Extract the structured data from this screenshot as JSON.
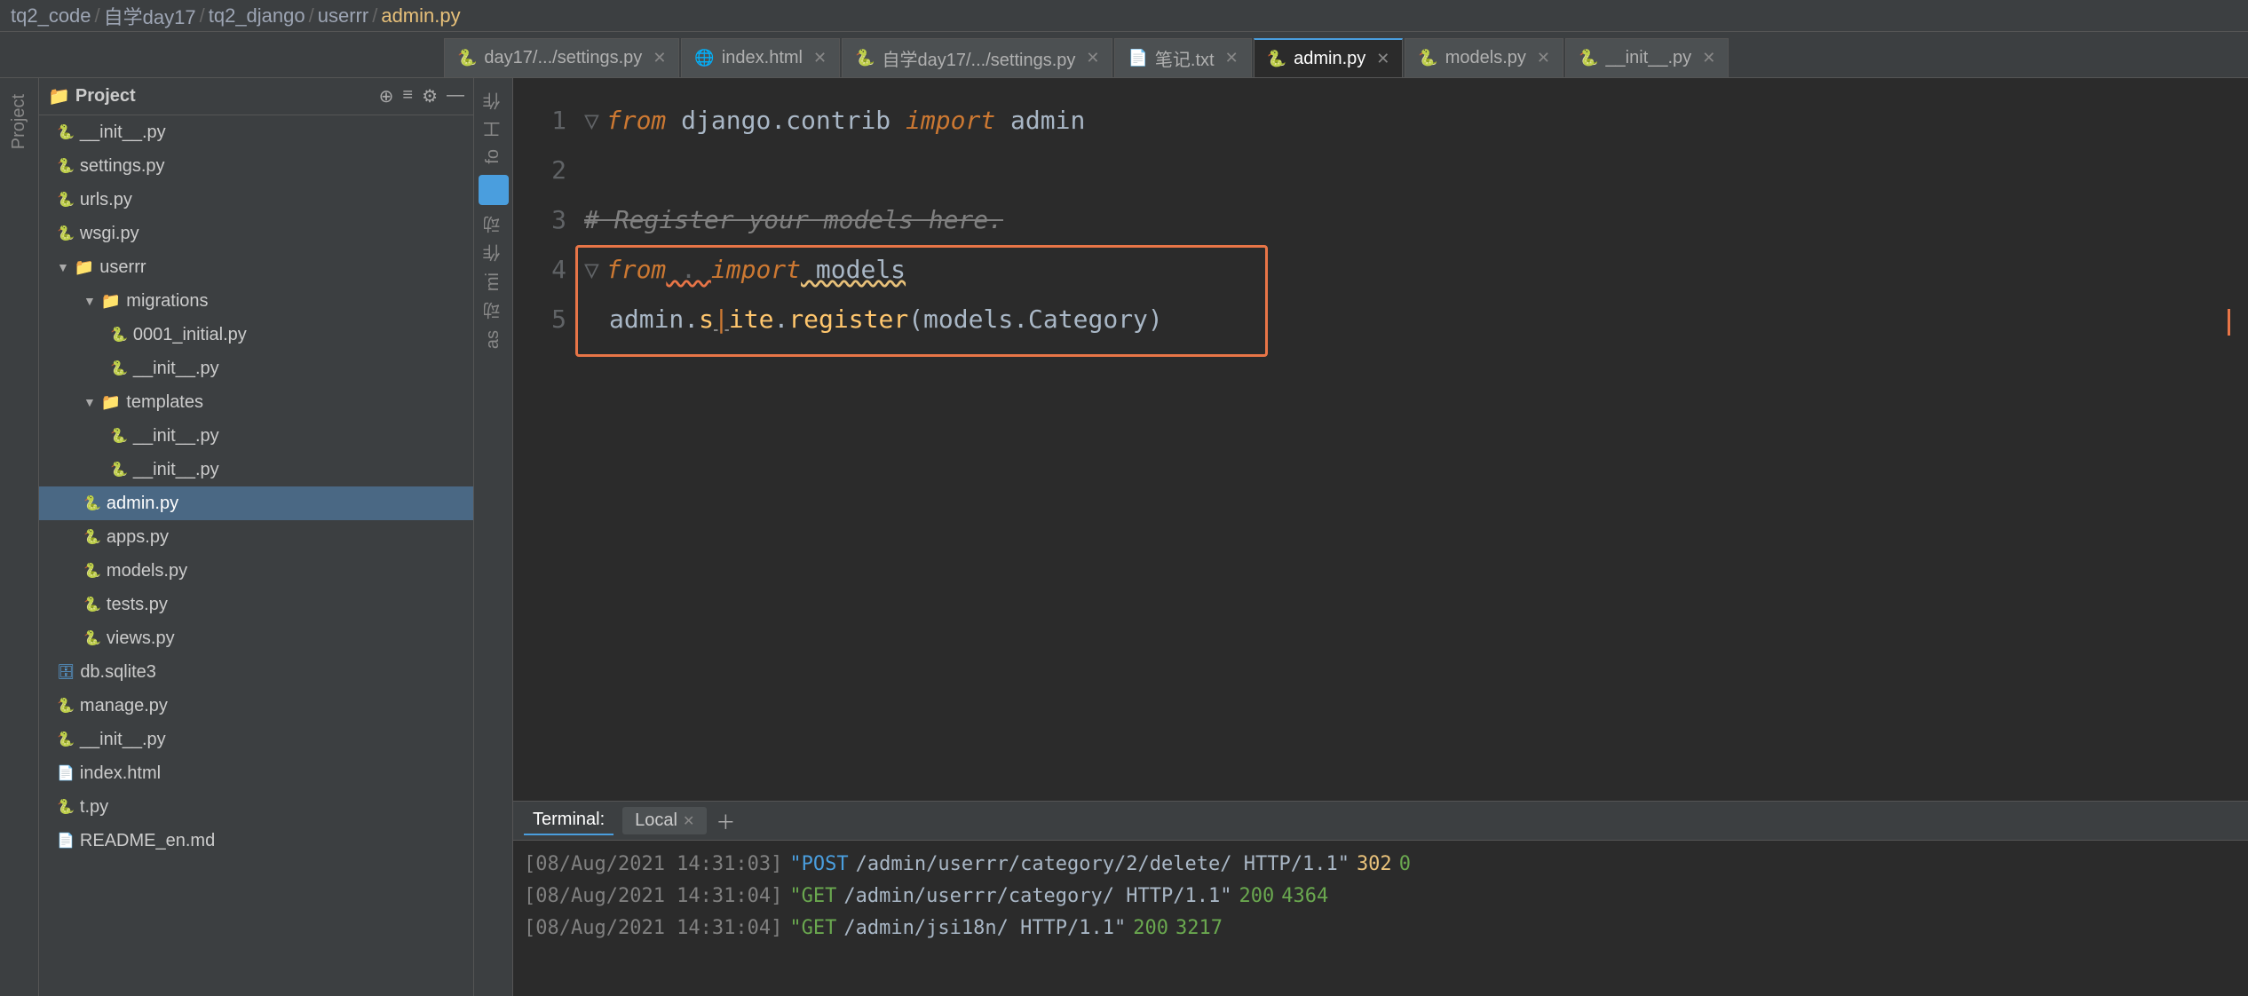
{
  "breadcrumb": {
    "items": [
      "tq2_code",
      "自学day17",
      "tq2_django",
      "userrr",
      "admin.py"
    ]
  },
  "tabs": [
    {
      "id": "day17-settings",
      "label": "day17/.../settings.py",
      "icon": "🐍",
      "type": "py",
      "active": false
    },
    {
      "id": "index-html",
      "label": "index.html",
      "icon": "🌐",
      "type": "html",
      "active": false
    },
    {
      "id": "zixue-settings",
      "label": "自学day17/.../settings.py",
      "icon": "🐍",
      "type": "py",
      "active": false
    },
    {
      "id": "notes-md",
      "label": "笔记.txt",
      "icon": "📄",
      "type": "txt",
      "active": false
    },
    {
      "id": "admin-py",
      "label": "admin.py",
      "icon": "🐍",
      "type": "py",
      "active": true
    },
    {
      "id": "models-py",
      "label": "models.py",
      "icon": "🐍",
      "type": "py",
      "active": false
    },
    {
      "id": "init-py",
      "label": "__init__.py",
      "icon": "🐍",
      "type": "py",
      "active": false
    }
  ],
  "project_panel": {
    "title": "Project",
    "items": [
      {
        "level": 0,
        "type": "file",
        "name": "__init__.py",
        "icon": "py"
      },
      {
        "level": 0,
        "type": "file",
        "name": "settings.py",
        "icon": "py"
      },
      {
        "level": 0,
        "type": "file",
        "name": "urls.py",
        "icon": "py"
      },
      {
        "level": 0,
        "type": "file",
        "name": "wsgi.py",
        "icon": "py"
      },
      {
        "level": 0,
        "type": "folder",
        "name": "userrr",
        "icon": "folder",
        "open": true
      },
      {
        "level": 1,
        "type": "folder",
        "name": "migrations",
        "icon": "folder",
        "open": true
      },
      {
        "level": 2,
        "type": "file",
        "name": "0001_initial.py",
        "icon": "py"
      },
      {
        "level": 2,
        "type": "file",
        "name": "__init__.py",
        "icon": "py"
      },
      {
        "level": 1,
        "type": "folder",
        "name": "templates",
        "icon": "folder",
        "open": true
      },
      {
        "level": 2,
        "type": "file",
        "name": "__init__.py",
        "icon": "py"
      },
      {
        "level": 2,
        "type": "file",
        "name": "__init__.py",
        "icon": "py"
      },
      {
        "level": 1,
        "type": "file",
        "name": "admin.py",
        "icon": "py",
        "selected": true
      },
      {
        "level": 1,
        "type": "file",
        "name": "apps.py",
        "icon": "py"
      },
      {
        "level": 1,
        "type": "file",
        "name": "models.py",
        "icon": "py"
      },
      {
        "level": 1,
        "type": "file",
        "name": "tests.py",
        "icon": "py"
      },
      {
        "level": 1,
        "type": "file",
        "name": "views.py",
        "icon": "py"
      },
      {
        "level": 0,
        "type": "file",
        "name": "db.sqlite3",
        "icon": "db"
      },
      {
        "level": 0,
        "type": "file",
        "name": "manage.py",
        "icon": "py"
      },
      {
        "level": 0,
        "type": "file",
        "name": "__init__.py",
        "icon": "py"
      },
      {
        "level": 0,
        "type": "file",
        "name": "index.html",
        "icon": "html"
      },
      {
        "level": 0,
        "type": "file",
        "name": "t.py",
        "icon": "py"
      },
      {
        "level": 0,
        "type": "file",
        "name": "README_en.md",
        "icon": "md"
      }
    ]
  },
  "code": {
    "lines": [
      {
        "num": 1,
        "content_raw": "from django.contrib import admin"
      },
      {
        "num": 2,
        "content_raw": ""
      },
      {
        "num": 3,
        "content_raw": "# Register your models here."
      },
      {
        "num": 4,
        "content_raw": "from . import models"
      },
      {
        "num": 5,
        "content_raw": "admin.site.register(models.Category)"
      }
    ]
  },
  "terminal": {
    "tab_label": "Terminal:",
    "local_label": "Local",
    "plus_label": "+",
    "logs": [
      {
        "time": "[08/Aug/2021 14:31:03]",
        "method": "POST",
        "path": "/admin/userrr/category/2/delete/ HTTP/1.1",
        "status": "302",
        "size": "0"
      },
      {
        "time": "[08/Aug/2021 14:31:04]",
        "method": "GET",
        "path": "/admin/userrr/category/ HTTP/1.1",
        "status": "200",
        "size": "4364"
      },
      {
        "time": "[08/Aug/2021 14:31:04]",
        "method": "GET",
        "path": "/admin/jsi18n/ HTTP/1.1",
        "status": "200",
        "size": "3217"
      }
    ]
  },
  "side_labels": [
    "作",
    "工",
    "fo",
    "动",
    "作",
    "mi",
    "动",
    "as"
  ]
}
